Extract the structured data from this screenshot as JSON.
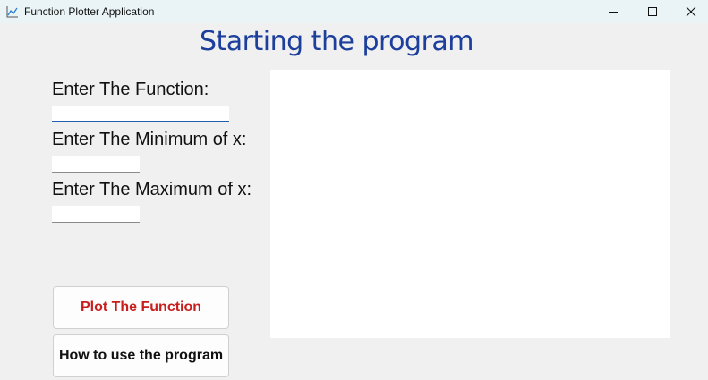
{
  "window": {
    "title": "Function Plotter Application",
    "icon": "chart-line-icon",
    "controls": {
      "minimize": "minimize-icon",
      "maximize": "maximize-icon",
      "close": "close-icon"
    }
  },
  "main": {
    "heading": "Starting the program",
    "function_label": "Enter The Function:",
    "function_value": "",
    "min_label": "Enter The Minimum of x:",
    "min_value": "",
    "max_label": "Enter The Maximum of x:",
    "max_value": ""
  },
  "buttons": {
    "plot_label": "Plot The Function",
    "help_label": "How to use the program"
  },
  "colors": {
    "heading": "#1d3f9c",
    "plot_button_text": "#c81e1e",
    "active_input_underline": "#1f5fae",
    "plot_area": "#ffffff",
    "background": "#f0f0f0"
  }
}
